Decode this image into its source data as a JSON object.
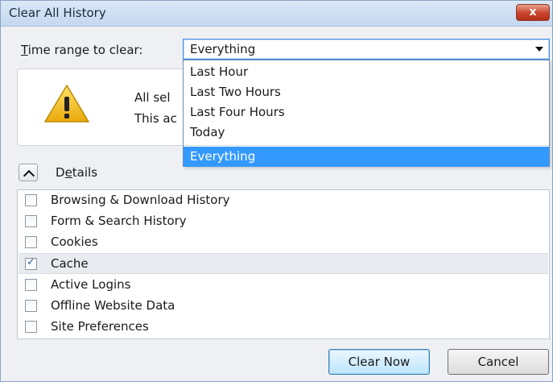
{
  "window": {
    "title": "Clear All History",
    "close_glyph": "x"
  },
  "time_range": {
    "label_accel": "T",
    "label_rest": "ime range to clear:",
    "selected": "Everything",
    "options": [
      "Last Hour",
      "Last Two Hours",
      "Last Four Hours",
      "Today",
      "Everything"
    ]
  },
  "warning": {
    "line1": "All sel",
    "line2": "This ac",
    "icon": "warning-icon"
  },
  "details": {
    "label_pre": "D",
    "label_accel": "e",
    "label_rest": "tails"
  },
  "items": [
    {
      "label": "Browsing & Download History",
      "checked": false
    },
    {
      "label": "Form & Search History",
      "checked": false
    },
    {
      "label": "Cookies",
      "checked": false
    },
    {
      "label": "Cache",
      "checked": true
    },
    {
      "label": "Active Logins",
      "checked": false
    },
    {
      "label": "Offline Website Data",
      "checked": false
    },
    {
      "label": "Site Preferences",
      "checked": false
    }
  ],
  "buttons": {
    "clear_now": "Clear Now",
    "cancel": "Cancel"
  },
  "colors": {
    "selection": "#3399ff",
    "close": "#c9432b",
    "warning_yellow": "#f3c21b"
  }
}
